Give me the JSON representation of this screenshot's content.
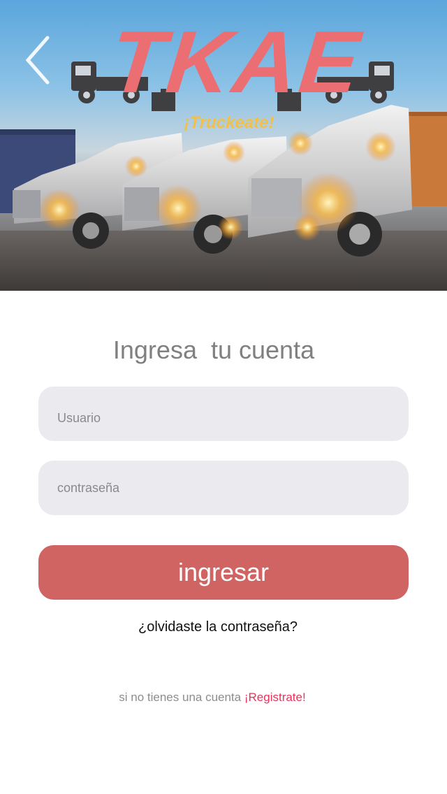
{
  "header": {
    "logo_title": "TKAE",
    "logo_slogan": "¡Truckeate!",
    "accent_color": "#ea6e72",
    "slogan_color": "#f0c04a"
  },
  "icons": {
    "back": "chevron-left-icon",
    "truck": "truck-icon",
    "box": "box-icon"
  },
  "form": {
    "title": "Ingresa  tu cuenta",
    "username_placeholder": "Usuario",
    "username_value": "",
    "password_placeholder": "contraseña",
    "password_value": "",
    "submit_label": "ingresar",
    "submit_color": "#d06463",
    "forgot_label": "¿olvidaste la contraseña?",
    "register_prompt": "si no tienes una cuenta ",
    "register_link": "¡Registrate!",
    "register_link_color": "#e8325a"
  }
}
